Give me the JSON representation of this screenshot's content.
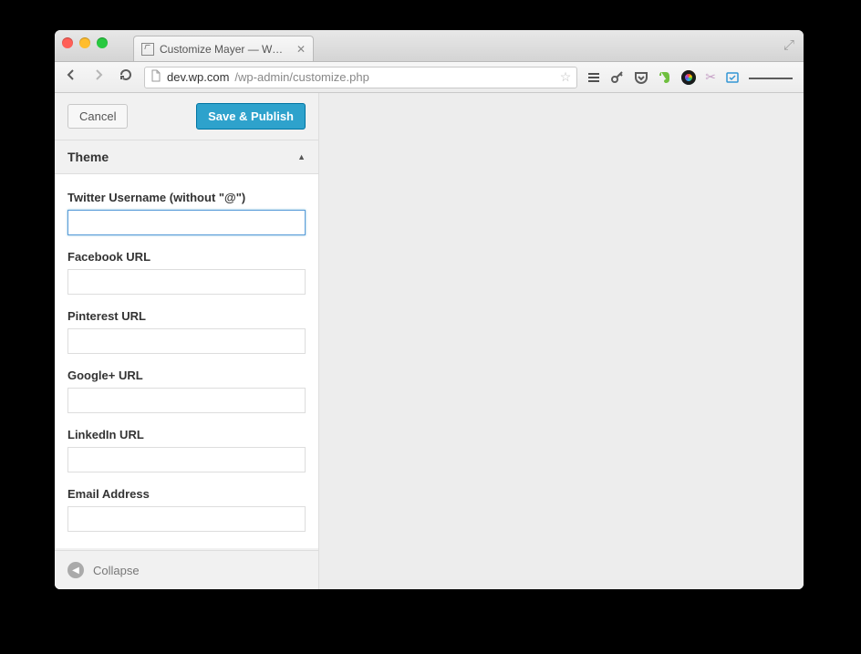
{
  "browser": {
    "tab_title": "Customize Mayer — WordP",
    "url_host": "dev.wp.com",
    "url_path": "/wp-admin/customize.php"
  },
  "actions": {
    "cancel": "Cancel",
    "save": "Save & Publish"
  },
  "section": {
    "title": "Theme"
  },
  "fields": [
    {
      "label": "Twitter Username (without \"@\")",
      "value": ""
    },
    {
      "label": "Facebook URL",
      "value": ""
    },
    {
      "label": "Pinterest URL",
      "value": ""
    },
    {
      "label": "Google+ URL",
      "value": ""
    },
    {
      "label": "LinkedIn URL",
      "value": ""
    },
    {
      "label": "Email Address",
      "value": ""
    }
  ],
  "footer": {
    "collapse": "Collapse"
  },
  "colors": {
    "primary_accent": "#2ea2cc"
  }
}
